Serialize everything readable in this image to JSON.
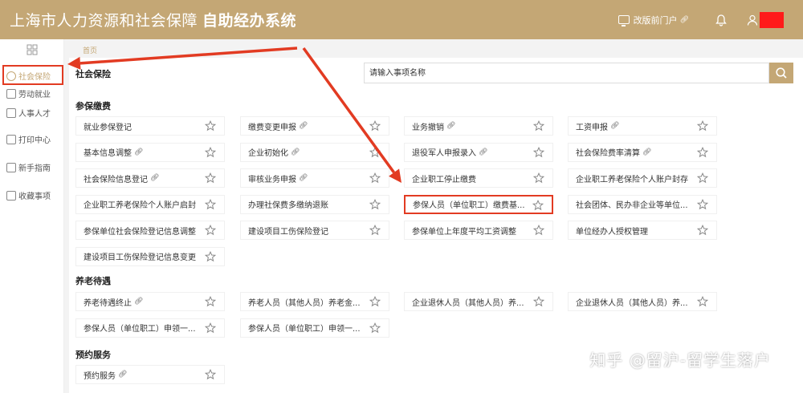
{
  "header": {
    "title_main": "上海市人力资源和社会保障",
    "title_bold": "自助经办系统",
    "portal_label": "改版前门户",
    "bg_color": "#c4a775"
  },
  "sidebar": {
    "items": [
      {
        "label": "社会保险",
        "icon": "shield-icon",
        "active": true
      },
      {
        "label": "劳动就业",
        "icon": "worker-icon"
      },
      {
        "label": "人事人才",
        "icon": "person-icon"
      },
      {
        "label": "打印中心",
        "icon": "printer-icon"
      },
      {
        "label": "新手指南",
        "icon": "guide-icon"
      },
      {
        "label": "收藏事项",
        "icon": "star-icon"
      }
    ]
  },
  "breadcrumb": "首页",
  "panel_title": "社会保险",
  "search": {
    "placeholder": "请输入事项名称"
  },
  "sections": [
    {
      "title": "参保缴费",
      "items": [
        {
          "label": "就业参保登记",
          "link": false
        },
        {
          "label": "缴费变更申报",
          "link": true
        },
        {
          "label": "业务撤销",
          "link": true
        },
        {
          "label": "工资申报",
          "link": true
        },
        {
          "label": "基本信息调整",
          "link": true
        },
        {
          "label": "企业初始化",
          "link": true
        },
        {
          "label": "退役军人申报录入",
          "link": true
        },
        {
          "label": "社会保险费率清算",
          "link": true
        },
        {
          "label": "社会保险信息登记",
          "link": true
        },
        {
          "label": "审核业务申报",
          "link": true
        },
        {
          "label": "企业职工停止缴费",
          "link": false
        },
        {
          "label": "企业职工养老保险个人账户封存",
          "link": false
        },
        {
          "label": "企业职工养老保险个人账户启封",
          "link": false
        },
        {
          "label": "办理社保费多缴纳退账",
          "link": false
        },
        {
          "label": "参保人员（单位职工）缴费基...",
          "link": false,
          "highlight": true
        },
        {
          "label": "社会团体、民办非企业等单位...",
          "link": false
        },
        {
          "label": "参保单位社会保险登记信息调整",
          "link": false
        },
        {
          "label": "建设项目工伤保险登记",
          "link": false
        },
        {
          "label": "参保单位上年度平均工资调整",
          "link": false
        },
        {
          "label": "单位经办人授权管理",
          "link": false
        },
        {
          "label": "建设项目工伤保险登记信息变更",
          "link": false
        }
      ]
    },
    {
      "title": "养老待遇",
      "items": [
        {
          "label": "养老待遇终止",
          "link": true
        },
        {
          "label": "养老人员（其他人员）养老金...",
          "link": false
        },
        {
          "label": "企业退休人员（其他人员）养...",
          "link": false
        },
        {
          "label": "企业退休人员（其他人员）养...",
          "link": false
        },
        {
          "label": "参保人员（单位职工）申领一...",
          "link": false
        },
        {
          "label": "参保人员（单位职工）申领一...",
          "link": false
        }
      ]
    },
    {
      "title": "预约服务",
      "items": [
        {
          "label": "预约服务",
          "link": true
        }
      ]
    }
  ],
  "watermark": "知乎 @留沪-留学生落户",
  "annotation_color": "#e23b22"
}
